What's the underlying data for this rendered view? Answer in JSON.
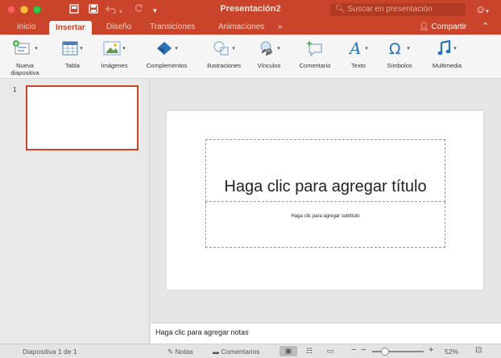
{
  "window": {
    "title": "Presentación2",
    "search_placeholder": "Suscar en presentación"
  },
  "tabs": [
    {
      "label": "Inicio",
      "active": false
    },
    {
      "label": "Insertar",
      "active": true
    },
    {
      "label": "Diseño",
      "active": false
    },
    {
      "label": "Transiciones",
      "active": false
    },
    {
      "label": "Animaciones",
      "active": false
    },
    {
      "label": "»",
      "active": false
    }
  ],
  "share_label": "Compartir",
  "ribbon": [
    {
      "label": "Nueva diapositiva",
      "icon": "new-slide-icon"
    },
    {
      "label": "Tabla",
      "icon": "table-icon"
    },
    {
      "label": "Imágenes",
      "icon": "pictures-icon"
    },
    {
      "label": "Complementos",
      "icon": "addins-icon"
    },
    {
      "label": "Ilustraciones",
      "icon": "illustrations-icon"
    },
    {
      "label": "Vínculos",
      "icon": "links-icon"
    },
    {
      "label": "Comentario",
      "icon": "comment-icon"
    },
    {
      "label": "Texto",
      "icon": "text-icon"
    },
    {
      "label": "Símbolos",
      "icon": "symbols-icon"
    },
    {
      "label": "Multimedia",
      "icon": "media-icon"
    }
  ],
  "thumbnails": [
    {
      "number": "1"
    }
  ],
  "slide": {
    "title_placeholder": "Haga clic para agregar título",
    "subtitle_placeholder": "Haga clic para agregar subtítulo"
  },
  "notes_placeholder": "Haga clic para agregar notas",
  "status": {
    "slide_counter": "Diapositiva 1 de 1",
    "notes_label": "Notas",
    "comments_label": "Comentarios",
    "zoom": "52%",
    "zoom_fraction": 0.25
  },
  "colors": {
    "accent": "#c9442a",
    "ribbon_bg": "#f5f5f5",
    "icon_blue": "#3a82c4"
  }
}
